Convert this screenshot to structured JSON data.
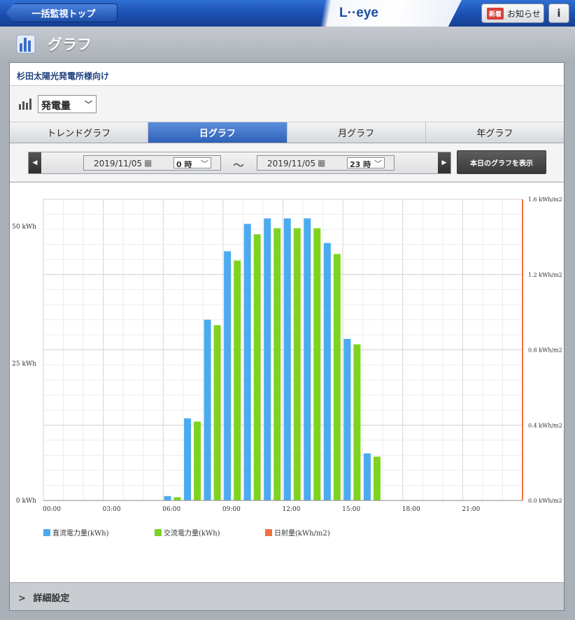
{
  "topbar": {
    "back_label": "一括監視トップ",
    "logo": "L··eye",
    "new_badge": "新着",
    "notice_label": "お知らせ",
    "info_label": "i"
  },
  "page_title": "グラフ",
  "plant_name": "杉田太陽光発電所様向け",
  "metric": {
    "selected": "発電量"
  },
  "tabs": [
    {
      "label": "トレンドグラフ",
      "active": false
    },
    {
      "label": "日グラフ",
      "active": true
    },
    {
      "label": "月グラフ",
      "active": false
    },
    {
      "label": "年グラフ",
      "active": false
    }
  ],
  "range": {
    "start_date": "2019/11/05",
    "start_hour": "0 時",
    "separator": "〜",
    "end_date": "2019/11/05",
    "end_hour": "23 時",
    "today_button": "本日のグラフを表示"
  },
  "chart_data": {
    "type": "bar",
    "x": [
      0,
      1,
      2,
      3,
      4,
      5,
      6,
      7,
      8,
      9,
      10,
      11,
      12,
      13,
      14,
      15,
      16,
      17,
      18,
      19,
      20,
      21,
      22,
      23
    ],
    "x_tick_labels": [
      "00:00",
      "03:00",
      "06:00",
      "09:00",
      "12:00",
      "15:00",
      "18:00",
      "21:00"
    ],
    "x_tick_values": [
      0,
      3,
      6,
      9,
      12,
      15,
      18,
      21
    ],
    "y_left_ticks": [
      "0 kWh",
      "25 kWh",
      "50 kWh"
    ],
    "y_left_tick_values": [
      0,
      25,
      50
    ],
    "ylim_left": [
      0,
      55
    ],
    "y_right_ticks": [
      "0.0 kWh/m2",
      "0.4 kWh/m2",
      "0.8 kWh/m2",
      "1.2 kWh/m2",
      "1.6 kWh/m2"
    ],
    "y_right_tick_values": [
      0,
      0.4,
      0.8,
      1.2,
      1.6
    ],
    "ylim_right": [
      0,
      1.6
    ],
    "grid": true,
    "legend_position": "bottom-left",
    "series": [
      {
        "name": "直流電力量(kWh)",
        "color": "#4aabf0",
        "axis": "left",
        "values": [
          0,
          0,
          0,
          0,
          0,
          0,
          0.8,
          15,
          33,
          45.5,
          50.5,
          51.5,
          51.5,
          51.5,
          47,
          29.5,
          8.6,
          0,
          0,
          0,
          0,
          0,
          0,
          0
        ]
      },
      {
        "name": "交流電力量(kWh)",
        "color": "#7ed321",
        "axis": "left",
        "values": [
          0,
          0,
          0,
          0,
          0,
          0,
          0.6,
          14.4,
          32,
          43.8,
          48.6,
          49.7,
          49.7,
          49.7,
          45,
          28.5,
          8,
          0,
          0,
          0,
          0,
          0,
          0,
          0
        ]
      },
      {
        "name": "日射量(kWh/m2)",
        "color": "#f07040",
        "axis": "right",
        "values": [
          0,
          0,
          0,
          0,
          0,
          0,
          0,
          0,
          0,
          0,
          0,
          0,
          0,
          0,
          0,
          0,
          0,
          0,
          0,
          0,
          0,
          0,
          0,
          0
        ]
      }
    ]
  },
  "detail_label": "詳細設定"
}
